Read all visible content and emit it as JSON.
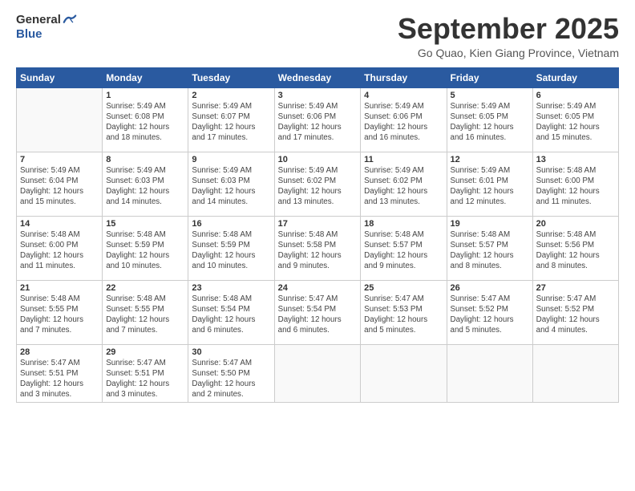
{
  "logo": {
    "general": "General",
    "blue": "Blue"
  },
  "header": {
    "month": "September 2025",
    "location": "Go Quao, Kien Giang Province, Vietnam"
  },
  "days_of_week": [
    "Sunday",
    "Monday",
    "Tuesday",
    "Wednesday",
    "Thursday",
    "Friday",
    "Saturday"
  ],
  "weeks": [
    [
      {
        "num": "",
        "info": ""
      },
      {
        "num": "1",
        "info": "Sunrise: 5:49 AM\nSunset: 6:08 PM\nDaylight: 12 hours\nand 18 minutes."
      },
      {
        "num": "2",
        "info": "Sunrise: 5:49 AM\nSunset: 6:07 PM\nDaylight: 12 hours\nand 17 minutes."
      },
      {
        "num": "3",
        "info": "Sunrise: 5:49 AM\nSunset: 6:06 PM\nDaylight: 12 hours\nand 17 minutes."
      },
      {
        "num": "4",
        "info": "Sunrise: 5:49 AM\nSunset: 6:06 PM\nDaylight: 12 hours\nand 16 minutes."
      },
      {
        "num": "5",
        "info": "Sunrise: 5:49 AM\nSunset: 6:05 PM\nDaylight: 12 hours\nand 16 minutes."
      },
      {
        "num": "6",
        "info": "Sunrise: 5:49 AM\nSunset: 6:05 PM\nDaylight: 12 hours\nand 15 minutes."
      }
    ],
    [
      {
        "num": "7",
        "info": "Sunrise: 5:49 AM\nSunset: 6:04 PM\nDaylight: 12 hours\nand 15 minutes."
      },
      {
        "num": "8",
        "info": "Sunrise: 5:49 AM\nSunset: 6:03 PM\nDaylight: 12 hours\nand 14 minutes."
      },
      {
        "num": "9",
        "info": "Sunrise: 5:49 AM\nSunset: 6:03 PM\nDaylight: 12 hours\nand 14 minutes."
      },
      {
        "num": "10",
        "info": "Sunrise: 5:49 AM\nSunset: 6:02 PM\nDaylight: 12 hours\nand 13 minutes."
      },
      {
        "num": "11",
        "info": "Sunrise: 5:49 AM\nSunset: 6:02 PM\nDaylight: 12 hours\nand 13 minutes."
      },
      {
        "num": "12",
        "info": "Sunrise: 5:49 AM\nSunset: 6:01 PM\nDaylight: 12 hours\nand 12 minutes."
      },
      {
        "num": "13",
        "info": "Sunrise: 5:48 AM\nSunset: 6:00 PM\nDaylight: 12 hours\nand 11 minutes."
      }
    ],
    [
      {
        "num": "14",
        "info": "Sunrise: 5:48 AM\nSunset: 6:00 PM\nDaylight: 12 hours\nand 11 minutes."
      },
      {
        "num": "15",
        "info": "Sunrise: 5:48 AM\nSunset: 5:59 PM\nDaylight: 12 hours\nand 10 minutes."
      },
      {
        "num": "16",
        "info": "Sunrise: 5:48 AM\nSunset: 5:59 PM\nDaylight: 12 hours\nand 10 minutes."
      },
      {
        "num": "17",
        "info": "Sunrise: 5:48 AM\nSunset: 5:58 PM\nDaylight: 12 hours\nand 9 minutes."
      },
      {
        "num": "18",
        "info": "Sunrise: 5:48 AM\nSunset: 5:57 PM\nDaylight: 12 hours\nand 9 minutes."
      },
      {
        "num": "19",
        "info": "Sunrise: 5:48 AM\nSunset: 5:57 PM\nDaylight: 12 hours\nand 8 minutes."
      },
      {
        "num": "20",
        "info": "Sunrise: 5:48 AM\nSunset: 5:56 PM\nDaylight: 12 hours\nand 8 minutes."
      }
    ],
    [
      {
        "num": "21",
        "info": "Sunrise: 5:48 AM\nSunset: 5:55 PM\nDaylight: 12 hours\nand 7 minutes."
      },
      {
        "num": "22",
        "info": "Sunrise: 5:48 AM\nSunset: 5:55 PM\nDaylight: 12 hours\nand 7 minutes."
      },
      {
        "num": "23",
        "info": "Sunrise: 5:48 AM\nSunset: 5:54 PM\nDaylight: 12 hours\nand 6 minutes."
      },
      {
        "num": "24",
        "info": "Sunrise: 5:47 AM\nSunset: 5:54 PM\nDaylight: 12 hours\nand 6 minutes."
      },
      {
        "num": "25",
        "info": "Sunrise: 5:47 AM\nSunset: 5:53 PM\nDaylight: 12 hours\nand 5 minutes."
      },
      {
        "num": "26",
        "info": "Sunrise: 5:47 AM\nSunset: 5:52 PM\nDaylight: 12 hours\nand 5 minutes."
      },
      {
        "num": "27",
        "info": "Sunrise: 5:47 AM\nSunset: 5:52 PM\nDaylight: 12 hours\nand 4 minutes."
      }
    ],
    [
      {
        "num": "28",
        "info": "Sunrise: 5:47 AM\nSunset: 5:51 PM\nDaylight: 12 hours\nand 3 minutes."
      },
      {
        "num": "29",
        "info": "Sunrise: 5:47 AM\nSunset: 5:51 PM\nDaylight: 12 hours\nand 3 minutes."
      },
      {
        "num": "30",
        "info": "Sunrise: 5:47 AM\nSunset: 5:50 PM\nDaylight: 12 hours\nand 2 minutes."
      },
      {
        "num": "",
        "info": ""
      },
      {
        "num": "",
        "info": ""
      },
      {
        "num": "",
        "info": ""
      },
      {
        "num": "",
        "info": ""
      }
    ]
  ]
}
